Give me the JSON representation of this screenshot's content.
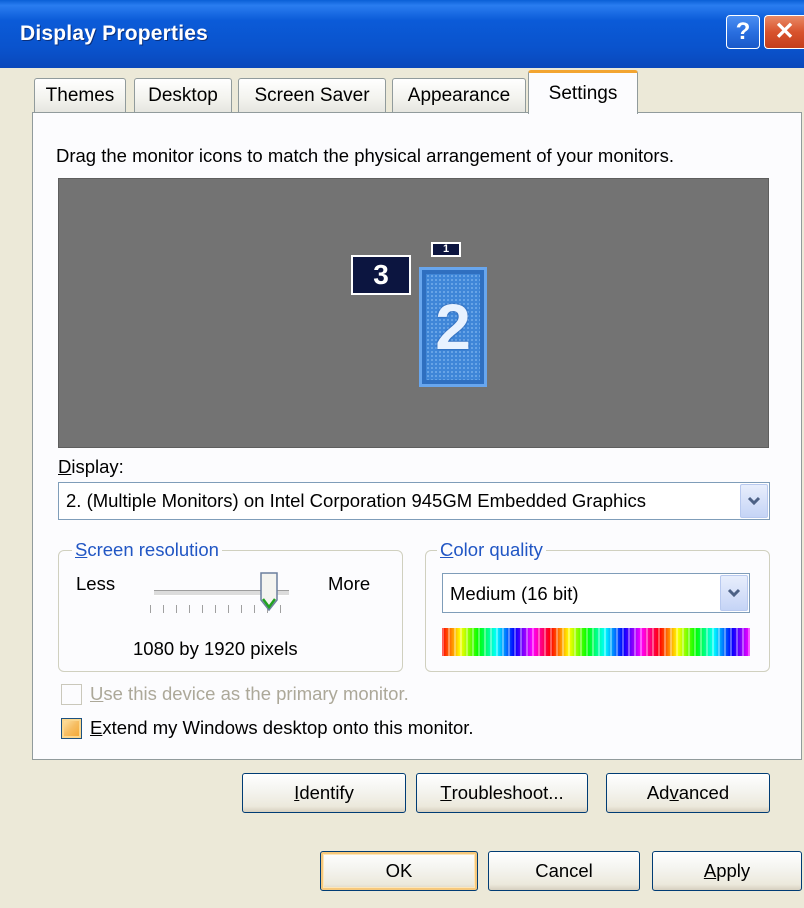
{
  "window": {
    "title": "Display Properties",
    "help_glyph": "?",
    "close_glyph": "✕"
  },
  "tabs": [
    {
      "label": "Themes",
      "active": false
    },
    {
      "label": "Desktop",
      "active": false
    },
    {
      "label": "Screen Saver",
      "active": false
    },
    {
      "label": "Appearance",
      "active": false
    },
    {
      "label": "Settings",
      "active": true
    }
  ],
  "instructions": "Drag the monitor icons to match the physical arrangement of your monitors.",
  "monitors": [
    {
      "number": "3",
      "selected": false
    },
    {
      "number": "1",
      "selected": false
    },
    {
      "number": "2",
      "selected": true
    }
  ],
  "display": {
    "label_accel": "D",
    "label_rest": "isplay:",
    "value": "2. (Multiple Monitors) on Intel Corporation 945GM Embedded Graphics"
  },
  "screen_resolution": {
    "title_accel": "S",
    "title_rest": "creen resolution",
    "less": "Less",
    "more": "More",
    "value_text": "1080 by 1920 pixels",
    "slider_level": 0.8
  },
  "color_quality": {
    "title_accel": "C",
    "title_rest": "olor quality",
    "value": "Medium (16 bit)"
  },
  "checkboxes": {
    "primary_accel": "U",
    "primary_rest": "se this device as the primary monitor.",
    "primary_checked": false,
    "primary_enabled": false,
    "extend_accel": "E",
    "extend_rest": "xtend my Windows desktop onto this monitor.",
    "extend_checked": false
  },
  "buttons": {
    "identify_accel": "I",
    "identify_rest": "dentify",
    "troubleshoot_accel": "T",
    "troubleshoot_rest": "roubleshoot...",
    "advanced_pre": "Ad",
    "advanced_accel": "v",
    "advanced_rest": "anced",
    "ok": "OK",
    "cancel": "Cancel",
    "apply_accel": "A",
    "apply_rest": "pply"
  },
  "colors": {
    "titlebar": "#0a53cd",
    "face": "#ECE9D8",
    "tab_highlight": "#f3a531",
    "monitor_bg": "#737373",
    "selected_monitor": "#3f86d8",
    "group_title": "#2156c4"
  }
}
